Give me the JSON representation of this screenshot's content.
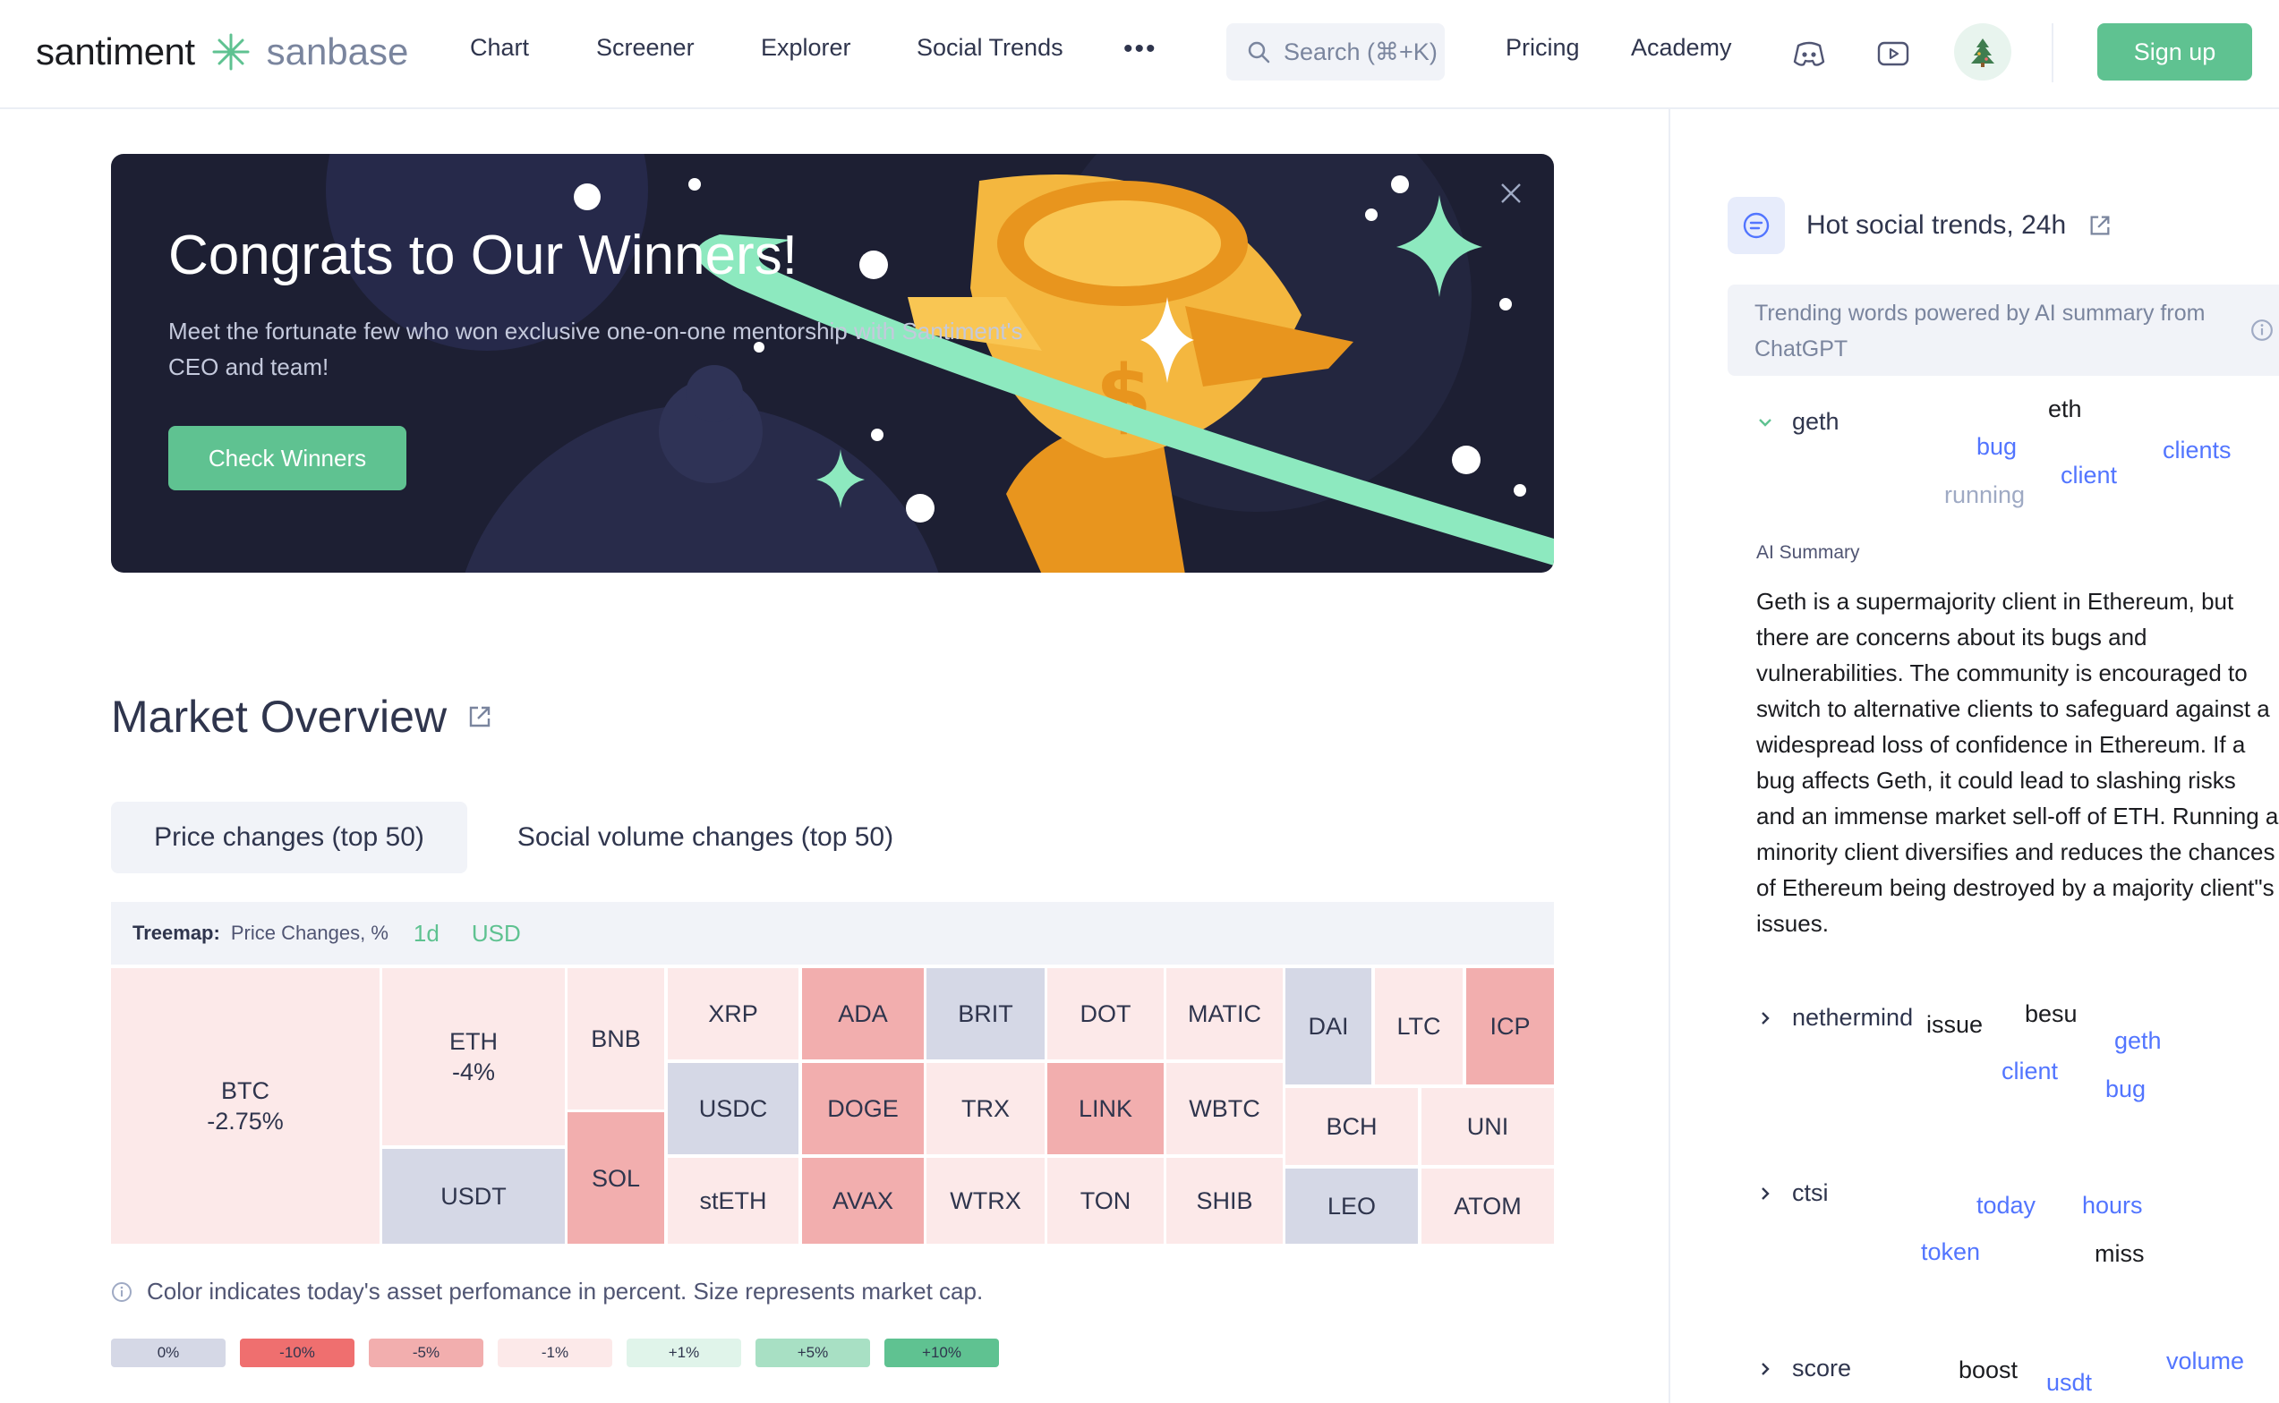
{
  "header": {
    "brand": "santiment",
    "product": "sanbase",
    "nav": [
      "Chart",
      "Screener",
      "Explorer",
      "Social Trends"
    ],
    "more_label": "•••",
    "search_placeholder": "Search (⌘+K)",
    "right_links": [
      "Pricing",
      "Academy"
    ],
    "icons": [
      "discord-icon",
      "youtube-icon",
      "christmas-tree-icon"
    ],
    "signup_label": "Sign up",
    "accent_color": "#5fc291"
  },
  "banner": {
    "title": "Congrats to Our Winners!",
    "text": "Meet the fortunate few who won exclusive one-on-one mentorship with Santiment's CEO and team!",
    "button_label": "Check Winners"
  },
  "market": {
    "title": "Market Overview",
    "tabs": [
      "Price changes (top 50)",
      "Social volume changes (top 50)"
    ],
    "treemap_label": "Treemap:",
    "treemap_metric": "Price Changes, %",
    "treemap_period": "1d",
    "treemap_currency": "USD",
    "cells": [
      {
        "name": "BTC",
        "change": "-2.75%"
      },
      {
        "name": "ETH",
        "change": "-4%"
      },
      {
        "name": "USDT",
        "change": ""
      },
      {
        "name": "BNB",
        "change": ""
      },
      {
        "name": "SOL",
        "change": ""
      },
      {
        "name": "XRP",
        "change": ""
      },
      {
        "name": "USDC",
        "change": ""
      },
      {
        "name": "stETH",
        "change": ""
      },
      {
        "name": "ADA",
        "change": ""
      },
      {
        "name": "DOGE",
        "change": ""
      },
      {
        "name": "AVAX",
        "change": ""
      },
      {
        "name": "BRIT",
        "change": ""
      },
      {
        "name": "TRX",
        "change": ""
      },
      {
        "name": "WTRX",
        "change": ""
      },
      {
        "name": "DOT",
        "change": ""
      },
      {
        "name": "LINK",
        "change": ""
      },
      {
        "name": "TON",
        "change": ""
      },
      {
        "name": "MATIC",
        "change": ""
      },
      {
        "name": "WBTC",
        "change": ""
      },
      {
        "name": "SHIB",
        "change": ""
      },
      {
        "name": "DAI",
        "change": ""
      },
      {
        "name": "LTC",
        "change": ""
      },
      {
        "name": "ICP",
        "change": ""
      },
      {
        "name": "BCH",
        "change": ""
      },
      {
        "name": "UNI",
        "change": ""
      },
      {
        "name": "LEO",
        "change": ""
      },
      {
        "name": "ATOM",
        "change": ""
      }
    ],
    "note": "Color indicates today's asset perfomance in percent. Size represents market cap.",
    "legend": [
      {
        "label": "0%",
        "color": "#d5d8e6"
      },
      {
        "label": "-10%",
        "color": "#ef6f6f"
      },
      {
        "label": "-5%",
        "color": "#f2aeae"
      },
      {
        "label": "-1%",
        "color": "#fce9e9"
      },
      {
        "label": "+1%",
        "color": "#e0f4ea"
      },
      {
        "label": "+5%",
        "color": "#a8e0c4"
      },
      {
        "label": "+10%",
        "color": "#5fc291"
      }
    ]
  },
  "trends": {
    "title": "Hot social trends, 24h",
    "ai_note": "Trending words powered by AI summary from ChatGPT",
    "items": [
      {
        "word": "geth",
        "related": [
          "eth",
          "bug",
          "clients",
          "client",
          "running"
        ]
      },
      {
        "word": "nethermind",
        "related": [
          "issue",
          "besu",
          "geth",
          "client",
          "bug"
        ]
      },
      {
        "word": "ctsi",
        "related": [
          "today",
          "hours",
          "token",
          "miss"
        ]
      },
      {
        "word": "score",
        "related": [
          "boost",
          "volume",
          "usdt"
        ]
      }
    ],
    "ai_summary_label": "AI Summary",
    "ai_summary": "Geth is a supermajority client in Ethereum, but there are concerns about its bugs and vulnerabilities. The community is encouraged to switch to alternative clients to safeguard against a widespread loss of confidence in Ethereum. If a bug affects Geth, it could lead to slashing risks and an immense market sell-off of ETH. Running a minority client diversifies and reduces the chances of Ethereum being destroyed by a majority client\"s issues."
  }
}
